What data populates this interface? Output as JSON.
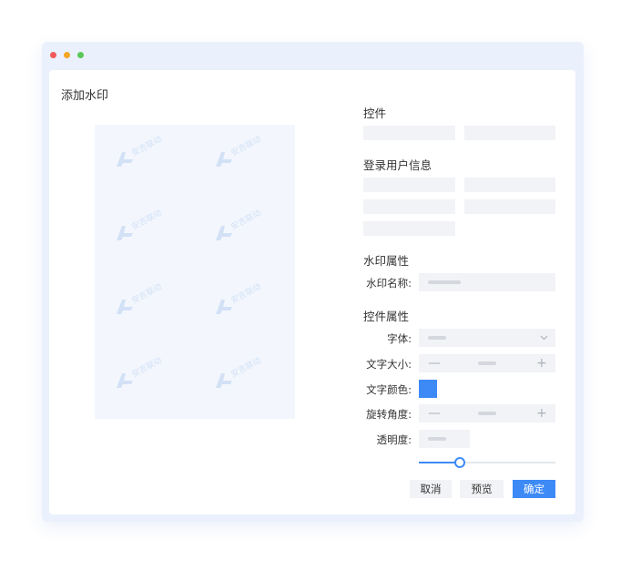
{
  "window": {
    "title": "添加水印",
    "dots": [
      "close",
      "minimize",
      "maximize"
    ]
  },
  "watermark_tile": {
    "text": "安吉联动",
    "rows": 4,
    "cols": 2
  },
  "form": {
    "sections": {
      "controls": "控件",
      "login_info": "登录用户信息",
      "watermark_props": "水印属性",
      "control_props": "控件属性"
    },
    "fields": {
      "watermark_name": "水印名称:",
      "font": "字体:",
      "font_size": "文字大小:",
      "text_color": "文字颜色:",
      "rotation": "旋转角度:",
      "opacity": "透明度:"
    },
    "steppers": {
      "minus": "—",
      "plus": "+"
    },
    "dropdown_icon": "chevron-down-icon",
    "text_color_value": "#3d8af7",
    "opacity_level": 0.3
  },
  "buttons": {
    "cancel": "取消",
    "preview": "预览",
    "ok": "确定"
  },
  "colors": {
    "accent": "#3d8af7",
    "window_bg": "#eaf1fc",
    "placeholder": "#f2f3f6"
  }
}
